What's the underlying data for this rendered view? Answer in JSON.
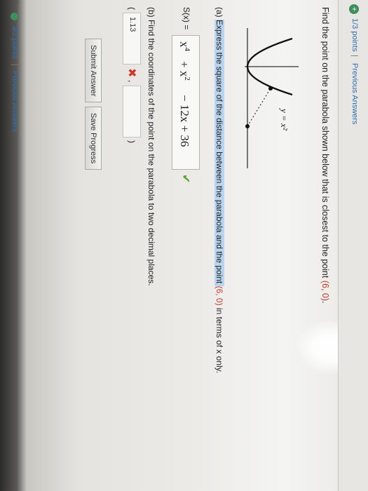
{
  "header": {
    "points": "1/3 points",
    "separator": "|",
    "previous_answers": "Previous Answers"
  },
  "problem": {
    "text": "Find the point on the parabola shown below that is closest to the point ",
    "point": "(6, 0)",
    "end": "."
  },
  "graph": {
    "curve_label": "y = x²"
  },
  "part_a": {
    "prefix": "(a) ",
    "highlighted": "Express the square of the distance between the parabola and the point ",
    "point": "(6, 0)",
    "suffix": " in terms of x only."
  },
  "answer_a": {
    "label": "S(x) =",
    "t1": "x",
    "e1": "4",
    "t2": "+ x",
    "e2": "2",
    "t3": "− 12x + 36",
    "status": "correct"
  },
  "part_b": {
    "text": "(b) Find the coordinates of the point on the parabola to two decimal places."
  },
  "answer_b": {
    "open_paren": "(",
    "x_value": "1.13",
    "comma": ",",
    "y_value": "",
    "close_paren": ")",
    "x_status": "incorrect"
  },
  "buttons": {
    "submit": "Submit Answer",
    "save": "Save Progress"
  },
  "footer": {
    "number": "7.",
    "points": "3/3 points",
    "separator": "|",
    "previous_answers": "Previous Answers"
  },
  "colors": {
    "link": "#2f6fb3",
    "highlight": "#b9d4ee",
    "correct": "#5aa32e",
    "incorrect": "#d0362c",
    "point_red": "#c0392b"
  },
  "icons": [
    "status-icon",
    "check-icon",
    "x-mark-icon"
  ]
}
